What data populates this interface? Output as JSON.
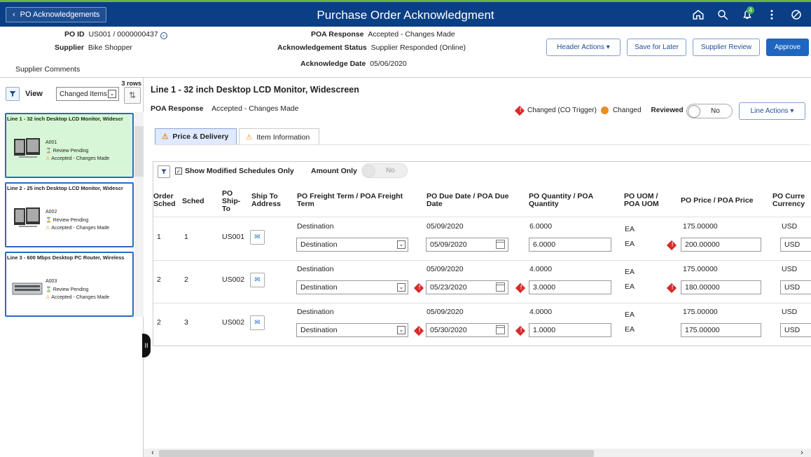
{
  "topbar": {
    "back_label": "PO Acknowledgements",
    "title": "Purchase Order Acknowledgment",
    "notification_count": "4",
    "icons": [
      "home-icon",
      "search-icon",
      "bell-icon",
      "more-icon",
      "no-icon"
    ]
  },
  "header": {
    "po_id_label": "PO ID",
    "po_id_value": "US001 / 0000000437",
    "supplier_label": "Supplier",
    "supplier_value": "Bike Shopper",
    "supplier_comments_label": "Supplier Comments",
    "poa_response_label": "POA Response",
    "poa_response_value": "Accepted - Changes Made",
    "ack_status_label": "Acknowledgement Status",
    "ack_status_value": "Supplier Responded (Online)",
    "ack_date_label": "Acknowledge Date",
    "ack_date_value": "05/06/2020",
    "buttons": {
      "header_actions": "Header Actions",
      "save_later": "Save for Later",
      "supplier_review": "Supplier Review",
      "approve": "Approve"
    }
  },
  "sidebar": {
    "rows": "3 rows",
    "view_label": "View",
    "view_value": "Changed Items",
    "cards": [
      {
        "title": "Line 1 - 32 inch Desktop LCD Monitor, Widescr",
        "id": "A001",
        "status": "Review Pending",
        "response": "Accepted - Changes Made"
      },
      {
        "title": "Line 2 - 25 inch Desktop LCD Monitor, Widescr",
        "id": "A002",
        "status": "Review Pending",
        "response": "Accepted - Changes Made"
      },
      {
        "title": "Line 3 - 600 Mbps Desktop PC Router, Wireless",
        "id": "A003",
        "status": "Review Pending",
        "response": "Accepted - Changes Made"
      }
    ]
  },
  "main": {
    "line_title": "Line 1 - 32 inch Desktop LCD Monitor, Widescreen",
    "poa_response_label": "POA Response",
    "poa_response_value": "Accepted - Changes Made",
    "legend_changed_trigger": "Changed (CO Trigger)",
    "legend_changed": "Changed",
    "reviewed_label": "Reviewed",
    "reviewed_value": "No",
    "line_actions": "Line Actions",
    "tabs": [
      "Price & Delivery",
      "Item Information"
    ],
    "show_modified": "Show Modified Schedules Only",
    "amount_only_label": "Amount Only",
    "amount_only_value": "No",
    "columns": {
      "order_sched": "Order Sched",
      "sched": "Sched",
      "po_ship_to": "PO Ship-To",
      "ship_to_address": "Ship To Address",
      "freight": "PO Freight Term / POA Freight Term",
      "due_date": "PO Due Date / POA Due Date",
      "quantity": "PO Quantity / POA Quantity",
      "uom": "PO UOM / POA UOM",
      "price": "PO Price / POA Price",
      "currency": "PO Curre Currency"
    },
    "rows": [
      {
        "order": "1",
        "sched": "1",
        "ship_to": "US001",
        "po_freight": "Destination",
        "poa_freight": "Destination",
        "po_due": "05/09/2020",
        "poa_due": "05/09/2020",
        "po_qty": "6.0000",
        "poa_qty": "6.0000",
        "po_uom": "EA",
        "poa_uom": "EA",
        "po_price": "175.00000",
        "poa_price": "200.00000",
        "po_currency": "USD",
        "poa_currency": "USD"
      },
      {
        "order": "2",
        "sched": "2",
        "ship_to": "US002",
        "po_freight": "Destination",
        "poa_freight": "Destination",
        "po_due": "05/09/2020",
        "poa_due": "05/23/2020",
        "po_qty": "4.0000",
        "poa_qty": "3.0000",
        "po_uom": "EA",
        "poa_uom": "EA",
        "po_price": "175.00000",
        "poa_price": "180.00000",
        "po_currency": "USD",
        "poa_currency": "USD"
      },
      {
        "order": "2",
        "sched": "3",
        "ship_to": "US002",
        "po_freight": "Destination",
        "poa_freight": "Destination",
        "po_due": "05/09/2020",
        "poa_due": "05/30/2020",
        "po_qty": "4.0000",
        "poa_qty": "1.0000",
        "po_uom": "EA",
        "poa_uom": "EA",
        "po_price": "175.00000",
        "poa_price": "175.00000",
        "po_currency": "USD",
        "poa_currency": "USD"
      }
    ]
  },
  "colors": {
    "topbar": "#0b3f85",
    "primary": "#1e66bf",
    "selected_card": "#d7f6d7",
    "changed_trigger": "#d92929",
    "changed": "#e98d25"
  }
}
